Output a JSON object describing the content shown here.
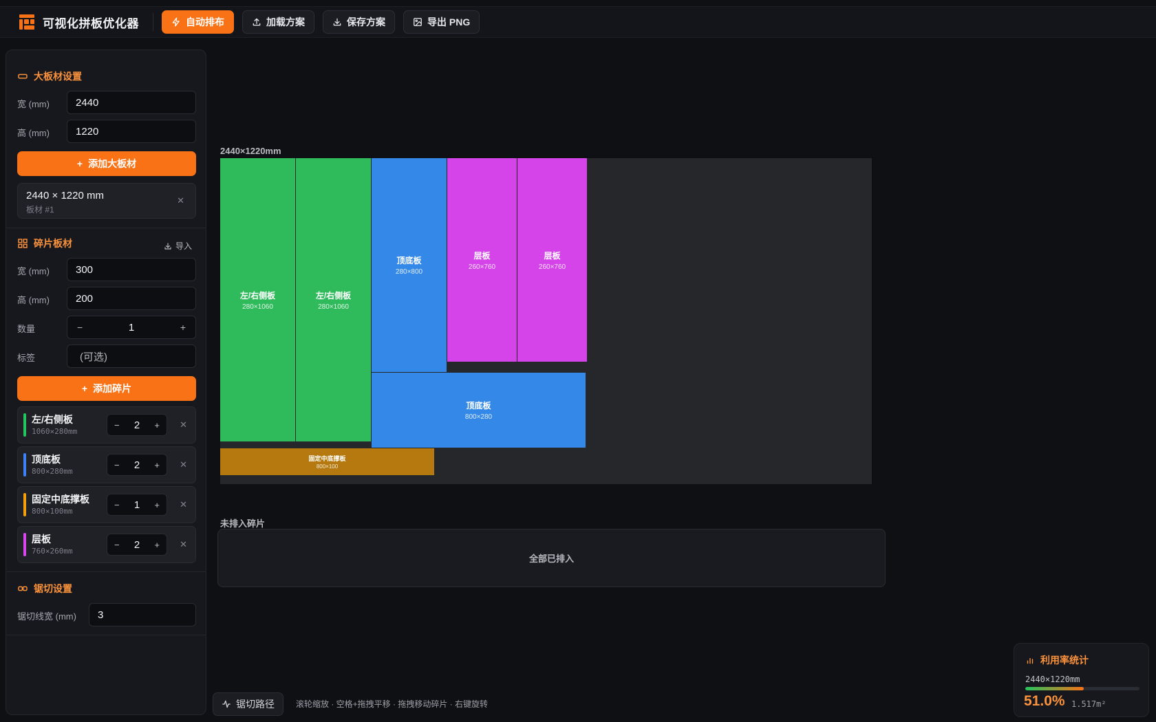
{
  "app": {
    "title": "可视化拼板优化器"
  },
  "toolbar": {
    "auto_label": "自动排布",
    "load_label": "加载方案",
    "save_label": "保存方案",
    "export_label": "导出 PNG"
  },
  "board_settings": {
    "title": "大板材设置",
    "width_label": "宽 (mm)",
    "width_value": "2440",
    "height_label": "高 (mm)",
    "height_value": "1220",
    "add_label": "添加大板材",
    "boards": [
      {
        "size": "2440 × 1220 mm",
        "sub": "板材 #1"
      }
    ]
  },
  "piece_settings": {
    "title": "碎片板材",
    "import_label": "导入",
    "width_label": "宽 (mm)",
    "width_value": "300",
    "height_label": "高 (mm)",
    "height_value": "200",
    "qty_label": "数量",
    "qty_value": "1",
    "tag_label": "标签",
    "tag_placeholder": "(可选)",
    "add_label": "添加碎片",
    "items": [
      {
        "name": "左/右侧板",
        "dim": "1060×280mm",
        "qty": "2",
        "color": "#22c55e"
      },
      {
        "name": "顶底板",
        "dim": "800×280mm",
        "qty": "2",
        "color": "#3b82f6"
      },
      {
        "name": "固定中底撑板",
        "dim": "800×100mm",
        "qty": "1",
        "color": "#f59e0b"
      },
      {
        "name": "层板",
        "dim": "760×260mm",
        "qty": "2",
        "color": "#d946ef"
      }
    ]
  },
  "saw_settings": {
    "title": "锯切设置",
    "kerf_label": "锯切线宽 (mm)",
    "kerf_value": "3"
  },
  "canvas": {
    "sheet_label": "2440×1220mm",
    "placed": [
      {
        "name": "左/右侧板",
        "dim": "280×1060",
        "color": "#2fbb5b"
      },
      {
        "name": "左/右侧板",
        "dim": "280×1060",
        "color": "#2fbb5b"
      },
      {
        "name": "顶底板",
        "dim": "280×800",
        "color": "#3388e8"
      },
      {
        "name": "层板",
        "dim": "260×760",
        "color": "#d444e8"
      },
      {
        "name": "层板",
        "dim": "260×760",
        "color": "#d444e8"
      },
      {
        "name": "顶底板",
        "dim": "800×280",
        "color": "#3388e8"
      },
      {
        "name": "固定中底撑板",
        "dim": "800×100",
        "color": "#b5790f"
      }
    ],
    "unplaced_label": "未排入碎片",
    "unplaced_empty": "全部已排入"
  },
  "bottom": {
    "saw_path_label": "锯切路径",
    "hint": "滚轮缩放 · 空格+拖拽平移 · 拖拽移动碎片 · 右键旋转"
  },
  "stats": {
    "title": "利用率统计",
    "sheet": "2440×1220mm",
    "utilization": 0.51,
    "percent_text": "51.0%",
    "area_text": "1.517m²"
  }
}
